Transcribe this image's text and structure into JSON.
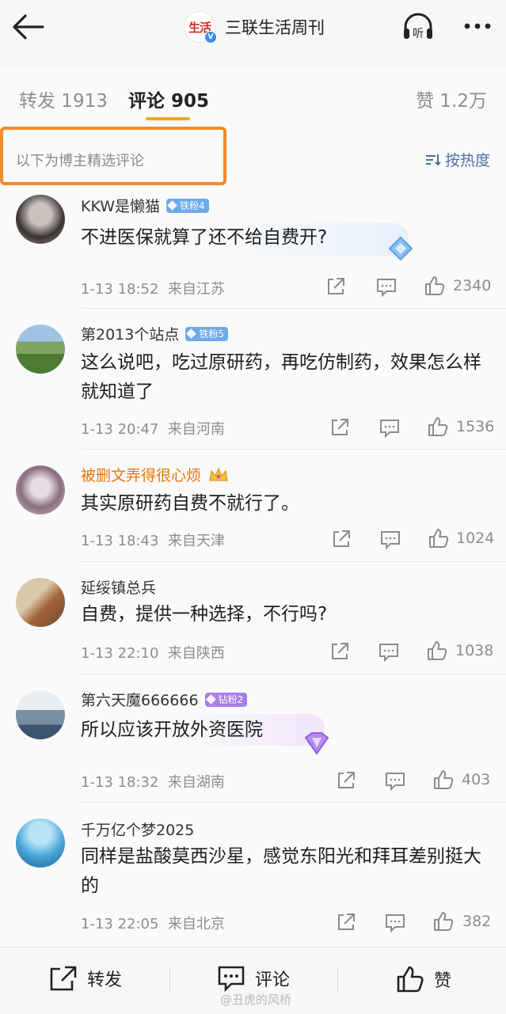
{
  "header": {
    "brand_logo_text": "生活",
    "brand_name": "三联生活周刊",
    "verified": "V"
  },
  "tabs": [
    {
      "label": "转发 1913"
    },
    {
      "label": "评论 905"
    },
    {
      "label": "赞 1.2万"
    }
  ],
  "filter": {
    "featured_label": "以下为博主精选评论",
    "sort_label": "按热度"
  },
  "comments": [
    {
      "user": "KKW是懒猫",
      "badge": "铁粉4",
      "text": "不进医保就算了还不给自费开?",
      "time": "1-13 18:52",
      "location": "来自江苏",
      "likes": "2340"
    },
    {
      "user": "第2013个站点",
      "badge": "铁粉5",
      "text": "这么说吧，吃过原研药，再吃仿制药，效果怎么样就知道了",
      "time": "1-13 20:47",
      "location": "来自河南",
      "likes": "1536"
    },
    {
      "user": "被删文弄得很心烦",
      "badge": "",
      "text": "其实原研药自费不就行了。",
      "time": "1-13 18:43",
      "location": "来自天津",
      "likes": "1024"
    },
    {
      "user": "延绥镇总兵",
      "badge": "",
      "text": "自费，提供一种选择，不行吗?",
      "time": "1-13 22:10",
      "location": "来自陕西",
      "likes": "1038"
    },
    {
      "user": "第六天魔666666",
      "badge": "钻粉2",
      "text": "所以应该开放外资医院",
      "time": "1-13 18:32",
      "location": "来自湖南",
      "likes": "403"
    },
    {
      "user": "千万亿个梦2025",
      "badge": "",
      "text": "同样是盐酸莫西沙星，感觉东阳光和拜耳差别挺大的",
      "time": "1-13 22:05",
      "location": "来自北京",
      "likes": "382"
    }
  ],
  "bottom": {
    "repost": "转发",
    "comment": "评论",
    "like": "赞"
  },
  "watermark": "@丑虎的风桥",
  "colors": {
    "accent": "#f5a623",
    "highlight_box": "#f58a2a",
    "link": "#4a6fa5"
  }
}
